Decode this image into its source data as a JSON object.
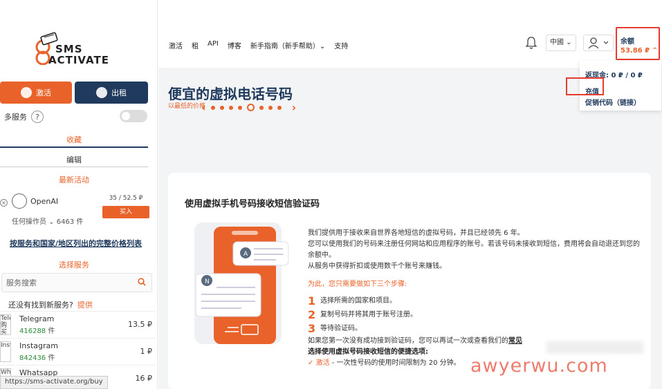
{
  "logo": {
    "line1": "SMS",
    "line2": "ACTIVATE"
  },
  "sidebar": {
    "activate_label": "激活",
    "rent_label": "出租",
    "multi_service_label": "多服务",
    "help_label": "?",
    "favorites_label": "收藏",
    "edit_label": "编辑",
    "latest_label": "最新活动",
    "promo": {
      "close_label": "×",
      "name": "OpenAI",
      "operator_label": "任何操作员 ⌄",
      "count": "6463 件",
      "price": "35 / 52.5 ₽",
      "buy_label": "买入"
    },
    "price_list_link": "按服务和国家/地区列出的完整价格列表",
    "choose_service_label": "选择服务",
    "search_placeholder": "服务搜索",
    "not_found_text": "还没有找到新服务?",
    "not_found_link": "提供",
    "services": [
      {
        "img_alt": "Tele 购买 短信",
        "name": "Telegram",
        "count": "416288",
        "unit": "件",
        "price": "13.5 ₽"
      },
      {
        "img_alt": "Insta",
        "name": "Instagram",
        "count": "842436",
        "unit": "件",
        "price": "1 ₽"
      },
      {
        "img_alt": "What",
        "name": "Whatsapp",
        "count": "",
        "unit": "",
        "price": "16 ₽"
      }
    ],
    "status_url": "https://sms-activate.org/buy"
  },
  "nav": {
    "items": [
      "激活",
      "租",
      "API",
      "博客",
      "新手指南（新手帮助）⌄",
      "支持"
    ],
    "language": "中國 ⌄",
    "balance_label": "余额",
    "balance_value": "53.86 ₽ ⌃"
  },
  "dropdown": {
    "cashback": "返现金: 0 ₽ / 0 ₽",
    "recharge": "充值",
    "promo_code": "促销代码（链接）"
  },
  "hero": {
    "title": "便宜的虚拟电话号码",
    "subtitle": "以最低的价格"
  },
  "card": {
    "title": "使用虚拟手机号码接收短信验证码",
    "p1": "我们提供用于接收来自世界各地短信的虚拟号码，并且已经领先 6 年。",
    "p2": "您可以使用我们的号码来注册任何网站和应用程序的账号。若该号码未接收到短信，费用将会自动退还到您的余额中。",
    "p3": "从服务中获得折扣或使用数千个账号来赚钱。",
    "steps_intro": "为此，您只需要做如下三个步骤:",
    "steps": [
      {
        "num": "1",
        "text": "选择所需的国家和项目。"
      },
      {
        "num": "2",
        "text": "复制号码并将其用于账号注册。"
      },
      {
        "num": "3",
        "text": "等待验证码。"
      }
    ],
    "retry_text": "如果您第一次没有成功接到验证码，您可以再试一次或查看我们的",
    "retry_link": "常见",
    "options_title": "选择使用虚拟号码接收短信的便捷选项:",
    "option1_name": "激活",
    "option1_text": " - 一次性号码的使用时间限制为 20 分钟。"
  },
  "watermark": "awyerwu.com",
  "colors": {
    "accent": "#e8622a",
    "navy": "#1f3a5c",
    "highlight": "#e63b2e"
  }
}
